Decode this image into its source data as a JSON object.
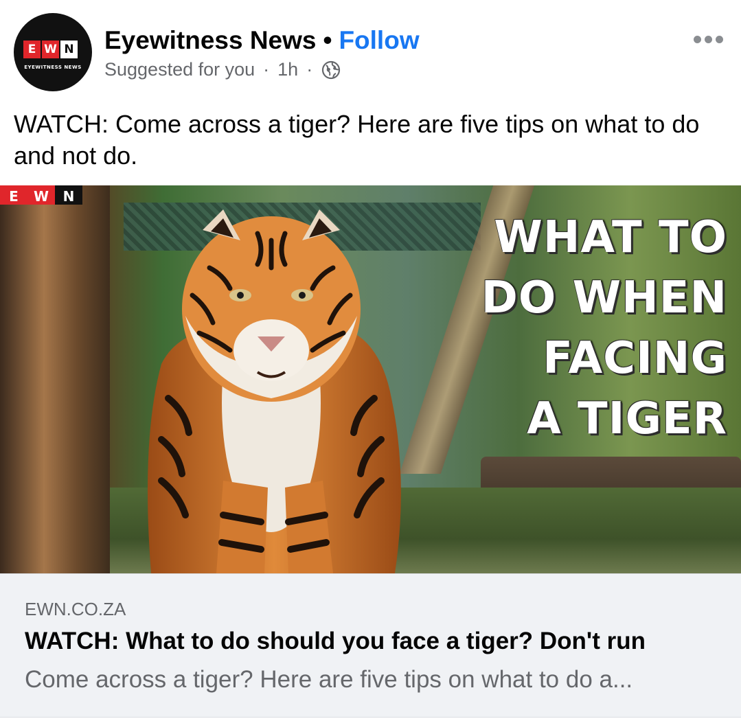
{
  "post": {
    "page_name": "Eyewitness News",
    "separator": "•",
    "follow_label": "Follow",
    "suggestion": "Suggested for you",
    "dot": "·",
    "time": "1h",
    "audience_icon": "globe-icon",
    "more_icon": "more-options-icon",
    "text": "WATCH: Come across a tiger? Here are five tips on what to do and not do."
  },
  "avatar": {
    "letters": [
      "E",
      "W",
      "N"
    ],
    "caption": "EYEWITNESS NEWS"
  },
  "media": {
    "watermark_letters": [
      "E",
      "W",
      "N"
    ],
    "headline_lines": [
      "WHAT TO",
      "DO WHEN",
      "FACING",
      "A TIGER"
    ]
  },
  "link_preview": {
    "domain": "EWN.CO.ZA",
    "title": "WATCH: What to do should you face a tiger? Don't run",
    "description": "Come across a tiger? Here are five tips on what to do a..."
  },
  "colors": {
    "follow": "#1877f2",
    "secondary_text": "#65676b",
    "preview_bg": "#f0f2f5",
    "logo_red": "#e0262b"
  }
}
